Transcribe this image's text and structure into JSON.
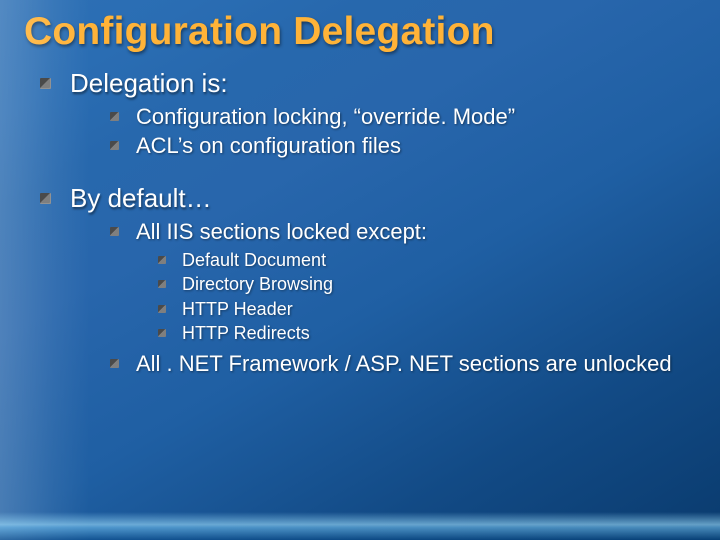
{
  "title": "Configuration Delegation",
  "sections": {
    "delegation_is": {
      "heading": "Delegation is:",
      "items": [
        "Configuration locking, “override. Mode”",
        "ACL’s on configuration files"
      ]
    },
    "by_default": {
      "heading": "By default…",
      "locked_except": {
        "heading": "All IIS sections locked except:",
        "items": [
          "Default Document",
          "Directory Browsing",
          "HTTP Header",
          "HTTP Redirects"
        ]
      },
      "unlocked": "All . NET Framework / ASP. NET sections are unlocked"
    }
  }
}
